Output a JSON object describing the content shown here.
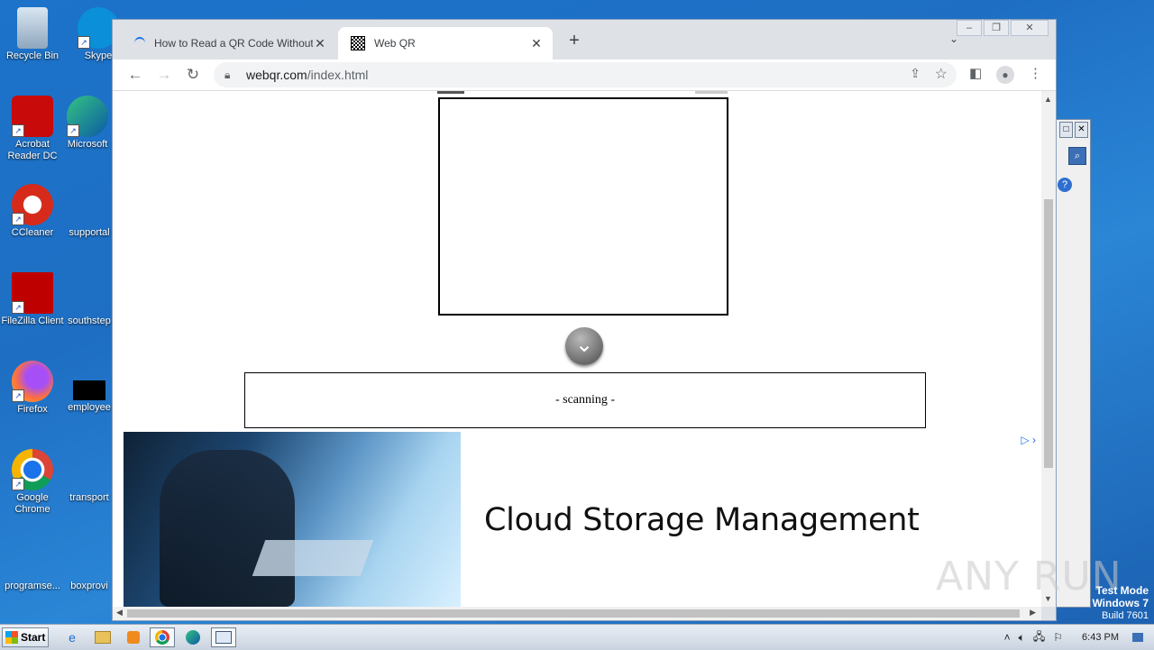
{
  "desktop": {
    "icons": [
      {
        "label": "Recycle Bin"
      },
      {
        "label": "Skype"
      },
      {
        "label": "Acrobat Reader DC"
      },
      {
        "label": "Microsoft"
      },
      {
        "label": "CCleaner"
      },
      {
        "label": "supportal"
      },
      {
        "label": "FileZilla Client"
      },
      {
        "label": "southstep"
      },
      {
        "label": "Firefox"
      },
      {
        "label": "employee"
      },
      {
        "label": "Google Chrome"
      },
      {
        "label": "transport"
      },
      {
        "label": "programse..."
      },
      {
        "label": "boxprovi"
      }
    ]
  },
  "browser": {
    "tabs": [
      {
        "title": "How to Read a QR Code Without a C",
        "active": false
      },
      {
        "title": "Web QR",
        "active": true
      }
    ],
    "new_tab_label": "+",
    "tab_menu_icon": "chevron-down-icon",
    "address": {
      "host": "webqr.com",
      "path": "/index.html"
    }
  },
  "page": {
    "result_text": "- scanning -",
    "ad": {
      "headline": "Cloud Storage Management"
    }
  },
  "watermark": "ANY RUN",
  "system": {
    "test_mode": "Test Mode",
    "os_name": "Windows 7",
    "build": "Build 7601",
    "start_label": "Start",
    "clock": "6:43 PM"
  }
}
